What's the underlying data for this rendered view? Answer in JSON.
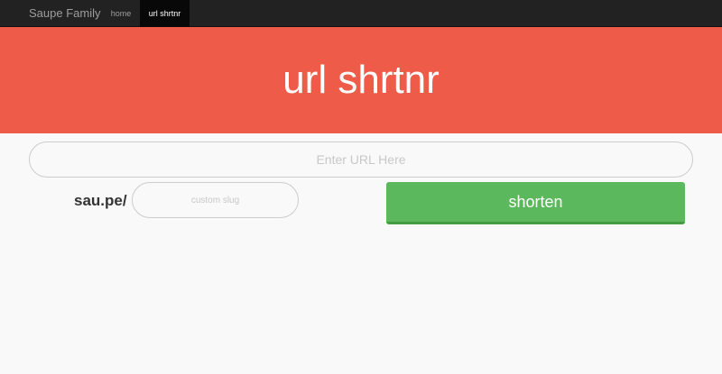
{
  "navbar": {
    "brand": "Saupe Family",
    "items": [
      {
        "label": "home"
      },
      {
        "label": "url shrtnr"
      }
    ]
  },
  "hero": {
    "title": "url shrtnr"
  },
  "form": {
    "url_placeholder": "Enter URL Here",
    "domain_prefix": "sau.pe/",
    "slug_placeholder": "custom slug",
    "submit_label": "shorten"
  },
  "colors": {
    "navbar_bg": "#222222",
    "hero_bg": "#ef5b49",
    "button_bg": "#5cb85c",
    "page_bg": "#f9f9f9"
  }
}
